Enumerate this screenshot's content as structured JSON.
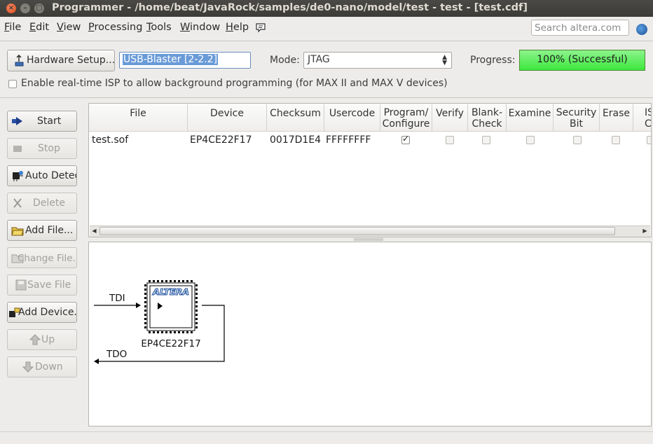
{
  "window": {
    "title": "Programmer - /home/beat/JavaRock/samples/de0-nano/model/test - test - [test.cdf]",
    "close_glyph": "×",
    "minimize_glyph": "–",
    "maximize_glyph": "□"
  },
  "menu": {
    "items": [
      {
        "label": "File",
        "underline": "F"
      },
      {
        "label": "Edit",
        "underline": "E"
      },
      {
        "label": "View",
        "underline": "V"
      },
      {
        "label": "Processing",
        "underline": "P"
      },
      {
        "label": "Tools",
        "underline": "T"
      },
      {
        "label": "Window",
        "underline": "W"
      },
      {
        "label": "Help",
        "underline": "H"
      }
    ],
    "search_placeholder": "Search altera.com"
  },
  "hardware": {
    "setup_label": "Hardware Setup...",
    "device": "USB-Blaster [2-2.2]",
    "mode_label": "Mode:",
    "mode_value": "JTAG",
    "progress_label": "Progress:",
    "progress_text": "100% (Successful)",
    "progress_value": 100,
    "progress_color": "#3de83d",
    "isp_label": "Enable real-time ISP to allow background programming (for MAX II and MAX V devices)",
    "isp_checked": false
  },
  "side_buttons": [
    {
      "label": "Start",
      "icon": "start-icon",
      "enabled": true
    },
    {
      "label": "Stop",
      "icon": "stop-icon",
      "enabled": false
    },
    {
      "label": "Auto Detect",
      "icon": "auto-detect-icon",
      "enabled": true
    },
    {
      "label": "Delete",
      "icon": "delete-icon",
      "enabled": false
    },
    {
      "label": "Add File...",
      "icon": "add-file-icon",
      "enabled": true
    },
    {
      "label": "Change File...",
      "icon": "change-file-icon",
      "enabled": false
    },
    {
      "label": "Save File",
      "icon": "save-file-icon",
      "enabled": false
    },
    {
      "label": "Add Device...",
      "icon": "add-device-icon",
      "enabled": true
    },
    {
      "label": "Up",
      "icon": "up-icon",
      "enabled": false
    },
    {
      "label": "Down",
      "icon": "down-icon",
      "enabled": false
    }
  ],
  "table": {
    "columns": [
      {
        "label": "File"
      },
      {
        "label": "Device"
      },
      {
        "label": "Checksum"
      },
      {
        "label": "Usercode"
      },
      {
        "label": "Program/\nConfigure"
      },
      {
        "label": "Verify"
      },
      {
        "label": "Blank-\nCheck"
      },
      {
        "label": "Examine"
      },
      {
        "label": "Security\nBit"
      },
      {
        "label": "Erase"
      },
      {
        "label": "ISP\nCLAMP"
      }
    ],
    "rows": [
      {
        "file": "test.sof",
        "device": "EP4CE22F17",
        "checksum": "0017D1E4",
        "usercode": "FFFFFFFF",
        "program": true,
        "verify": false,
        "blank_check": false,
        "examine": false,
        "security_bit": false,
        "erase": false,
        "isp_clamp": false
      }
    ]
  },
  "diagram": {
    "tdi_label": "TDI",
    "tdo_label": "TDO",
    "chip_logo": "ALTERA",
    "chip_name": "EP4CE22F17"
  }
}
